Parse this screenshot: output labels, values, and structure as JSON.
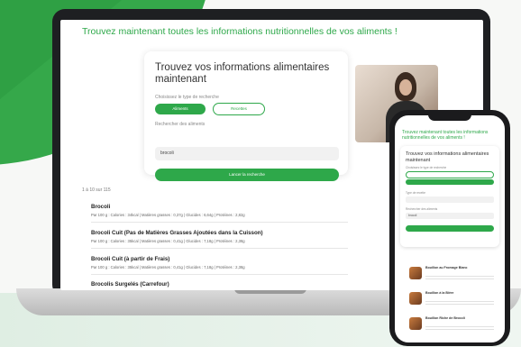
{
  "laptop": {
    "headline": "Trouvez maintenant toutes les informations nutritionnelles de vos aliments !",
    "search": {
      "title": "Trouvez vos informations alimentaires maintenant",
      "mode_label": "Choisissez le type de recherche",
      "mode_options": [
        "Aliments",
        "Recettes"
      ],
      "input_label": "Rechercher des aliments",
      "input_value": "brocoli",
      "submit_label": "Lancer la recherche"
    },
    "results_count": "1 à 10 sur 115",
    "results": [
      {
        "name": "Brocoli",
        "meta": "Par 100 g : Calories : 34kcal | Matières grasses : 0,37g | Glucides : 6,64g | Protéines : 2,82g"
      },
      {
        "name": "Brocoli Cuit (Pas de Matières Grasses Ajoutées dans la Cuisson)",
        "meta": "Par 100 g : Calories : 35kcal | Matières grasses : 0,41g | Glucides : 7,18g | Protéines : 2,38g"
      },
      {
        "name": "Brocoli Cuit (à partir de Frais)",
        "meta": "Par 100 g : Calories : 35kcal | Matières grasses : 0,41g | Glucides : 7,18g | Protéines : 2,38g"
      },
      {
        "name": "Brocolis Surgelés (Carrefour)",
        "meta": ""
      }
    ]
  },
  "phone": {
    "headline": "Trouvez maintenant toutes les informations nutritionnelles de vos aliments !",
    "title": "Trouvez vos informations alimentaires maintenant",
    "input_value": "brocoli",
    "items": [
      {
        "name": "Bouillon au Fromage Blanc"
      },
      {
        "name": "Bouillon à la Bière"
      },
      {
        "name": "Bouillon Riche de Brocoli"
      }
    ]
  },
  "colors": {
    "accent": "#2ea84a",
    "background_green": "#35a84a"
  }
}
